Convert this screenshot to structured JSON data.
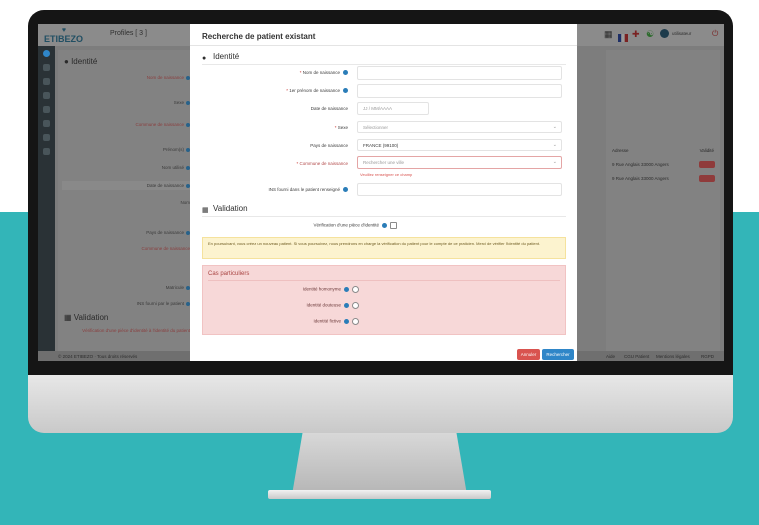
{
  "colors": {
    "teal_background": "#33b5b8",
    "modal_background": "#ffffff",
    "required_red": "#c9302c",
    "info_blue": "#2a7db8",
    "warning_bg": "#fcf3cf",
    "danger_bg": "#f7d8d8",
    "cancel_button": "#d9534f",
    "search_button": "#2f86c8"
  },
  "app": {
    "logo_text": "ETIBEZO",
    "patient_tab": "Profiles [ 3 ]"
  },
  "background": {
    "identity_heading": "Identité",
    "validation_heading": "Validation",
    "labels": [
      {
        "text": "Nom de naissance",
        "required": true
      },
      {
        "text": "Sexe",
        "required": false
      },
      {
        "text": "Commune de naissance",
        "required": true
      },
      {
        "text": "Prénom(s)",
        "required": false
      },
      {
        "text": "Nom utilisé",
        "required": false
      },
      {
        "text": "Date de naissance",
        "required": false
      },
      {
        "text": "Nom",
        "required": false
      },
      {
        "text": "Pays de naissance",
        "required": false
      },
      {
        "text": "Commune de naissance",
        "required": true
      },
      {
        "text": "Matricule",
        "required": false
      },
      {
        "text": "INS fourni par le patient",
        "required": false
      }
    ],
    "validation_note": "Vérification d'une pièce d'identité à l'identité du patient",
    "right_table": {
      "headers": [
        "Adresse",
        "Validité"
      ],
      "rows": [
        "9 Rue Anglais 33000 Angers",
        "9 Rue Anglais 33000 Angers"
      ]
    },
    "footer_left": "© 2024 ETIBEZO · Tous droits réservés",
    "footer_right": [
      "Aide",
      "CGU Patient",
      "Mentions légales",
      "RGPD"
    ],
    "user_name": "utilisateur"
  },
  "modal": {
    "title": "Recherche de patient existant",
    "identity_section": "Identité",
    "fields": {
      "nom_naissance": {
        "label": "Nom de naissance",
        "required": true,
        "value": ""
      },
      "prenom_naissance": {
        "label": "1er prénom de naissance",
        "required": true,
        "value": ""
      },
      "date_naissance": {
        "label": "Date de naissance",
        "required": false,
        "placeholder": "JJ / MM/AAAA"
      },
      "sexe": {
        "label": "Sexe",
        "required": true,
        "placeholder": "Sélectionner"
      },
      "pays_naissance": {
        "label": "Pays de naissance",
        "required": false,
        "value": "FRANCE (99100)"
      },
      "commune_naissance": {
        "label": "Commune de naissance",
        "required": true,
        "placeholder": "Rechercher une ville",
        "error": "Veuillez renseigner ce champ"
      },
      "ins_fourni": {
        "label": "INS fourni dans le patient renseigné",
        "required": false,
        "value": ""
      }
    },
    "validation_section": "Validation",
    "verification_label": "Vérification d'une pièce d'identité",
    "warning_text": "En poursuivant, vous créez un nouveau patient. Si vous poursuivez, nous prendrons en charge la vérification du patient pour le compte de ce praticien. Merci de vérifier l'identité du patient.",
    "cas_title": "Cas particuliers",
    "cas_items": [
      "Identité homonyme",
      "Identité douteuse",
      "Identité fictive"
    ],
    "buttons": {
      "cancel": "Annuler",
      "search": "Rechercher"
    }
  }
}
